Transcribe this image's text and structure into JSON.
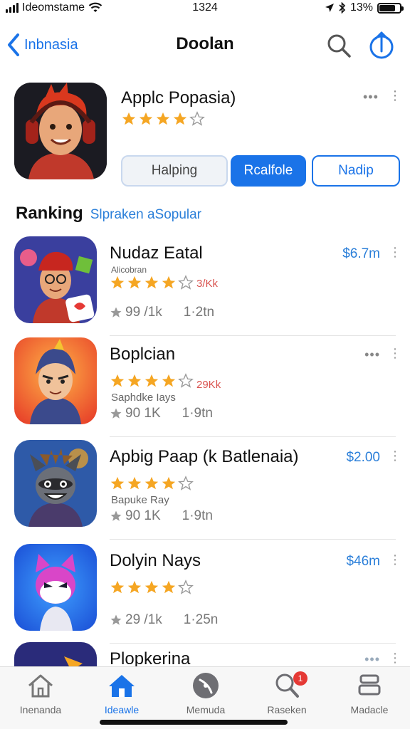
{
  "status_bar": {
    "carrier": "Ideomstame",
    "time": "1324",
    "battery": "13%",
    "battery_level": 0.8
  },
  "nav": {
    "back_label": "Inbnasia",
    "title": "Doolan"
  },
  "featured": {
    "name": "Applc Popasia)",
    "rating": 4,
    "buttons": [
      "Halping",
      "Rcalfole",
      "Nadip"
    ]
  },
  "ranking": {
    "title": "Ranking",
    "subtitle": "Slpraken aSopular"
  },
  "apps": [
    {
      "name": "Nudaz Eatal",
      "price": "$6.7m",
      "rating": 4,
      "count": "3/Kk",
      "developer": "Alicobran",
      "meta1": "99 /1k",
      "meta2": "1·2tn"
    },
    {
      "name": "Boplcian",
      "price": "",
      "rating": 4,
      "count": "29Kk",
      "developer": "Saphdke Iays",
      "meta1": "90 1K",
      "meta2": "1·9tn"
    },
    {
      "name": "Apbig Paap (k Batlenaia)",
      "price": "$2.00",
      "rating": 4,
      "count": "",
      "developer": "Bapuke Ray",
      "meta1": "90 1K",
      "meta2": "1·9tn"
    },
    {
      "name": "Dolyin Nays",
      "price": "$46m",
      "rating": 4,
      "count": "",
      "developer": "",
      "meta1": "29 /1k",
      "meta2": "1·25n"
    },
    {
      "name": "Plopkerina",
      "price": "",
      "rating": 0,
      "count": "",
      "developer": "",
      "meta1": "",
      "meta2": ""
    }
  ],
  "tabs": [
    {
      "label": "Inenanda",
      "icon": "home-outline-icon",
      "active": false
    },
    {
      "label": "Ideawle",
      "icon": "home-icon",
      "active": true
    },
    {
      "label": "Memuda",
      "icon": "disc-icon",
      "active": false
    },
    {
      "label": "Raseken",
      "icon": "search-icon",
      "active": false,
      "badge": "1"
    },
    {
      "label": "Madacle",
      "icon": "stack-icon",
      "active": false
    }
  ],
  "colors": {
    "accent": "#1a73e8",
    "star": "#f5a623",
    "badge": "#e53935"
  }
}
